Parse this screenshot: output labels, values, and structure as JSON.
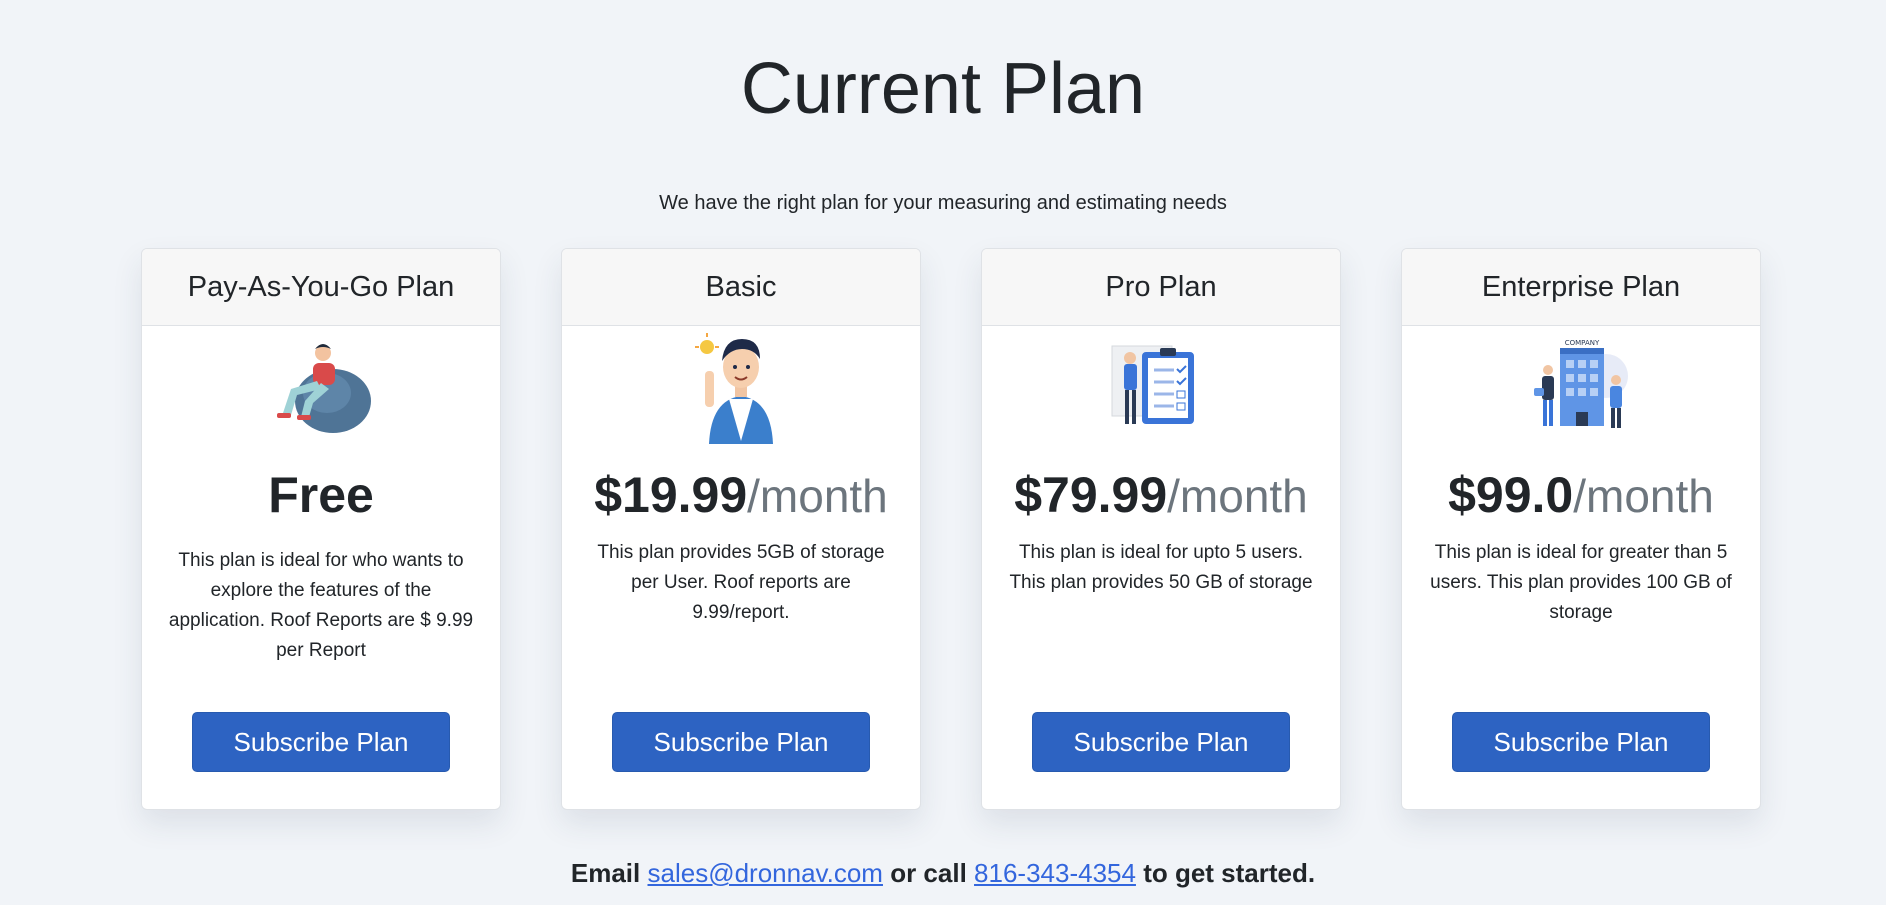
{
  "page": {
    "title": "Current Plan",
    "subtitle": "We have the right plan for your measuring and estimating needs"
  },
  "plans": [
    {
      "name": "Pay-As-You-Go Plan",
      "illustration": "person-on-beanbag-illustration",
      "price": "Free",
      "period": "",
      "description": "This plan is ideal for who wants to explore the features of the application. Roof Reports are $ 9.99 per Report",
      "button": "Subscribe Plan"
    },
    {
      "name": "Basic",
      "illustration": "man-with-idea-illustration",
      "price": "$19.99",
      "period": "/month",
      "description": "This plan provides 5GB of storage per User. Roof reports are 9.99/report.",
      "button": "Subscribe Plan"
    },
    {
      "name": "Pro Plan",
      "illustration": "checklist-board-illustration",
      "price": "$79.99",
      "period": "/month",
      "description": "This plan is ideal for upto 5 users. This plan provides 50 GB of storage",
      "button": "Subscribe Plan"
    },
    {
      "name": "Enterprise Plan",
      "illustration": "company-building-illustration",
      "price": "$99.0",
      "period": "/month",
      "description": "This plan is ideal for greater than 5 users. This plan provides 100 GB of storage",
      "button": "Subscribe Plan"
    }
  ],
  "footer": {
    "prefix": "Email",
    "email": "sales@dronnav.com",
    "middle": "or call",
    "phone": "816-343-4354",
    "suffix": "to get started.",
    "company_label": "COMPANY"
  },
  "colors": {
    "background": "#f1f4f8",
    "primary_button": "#2d63c2",
    "link": "#3366dd",
    "muted_text": "#6c757d"
  }
}
